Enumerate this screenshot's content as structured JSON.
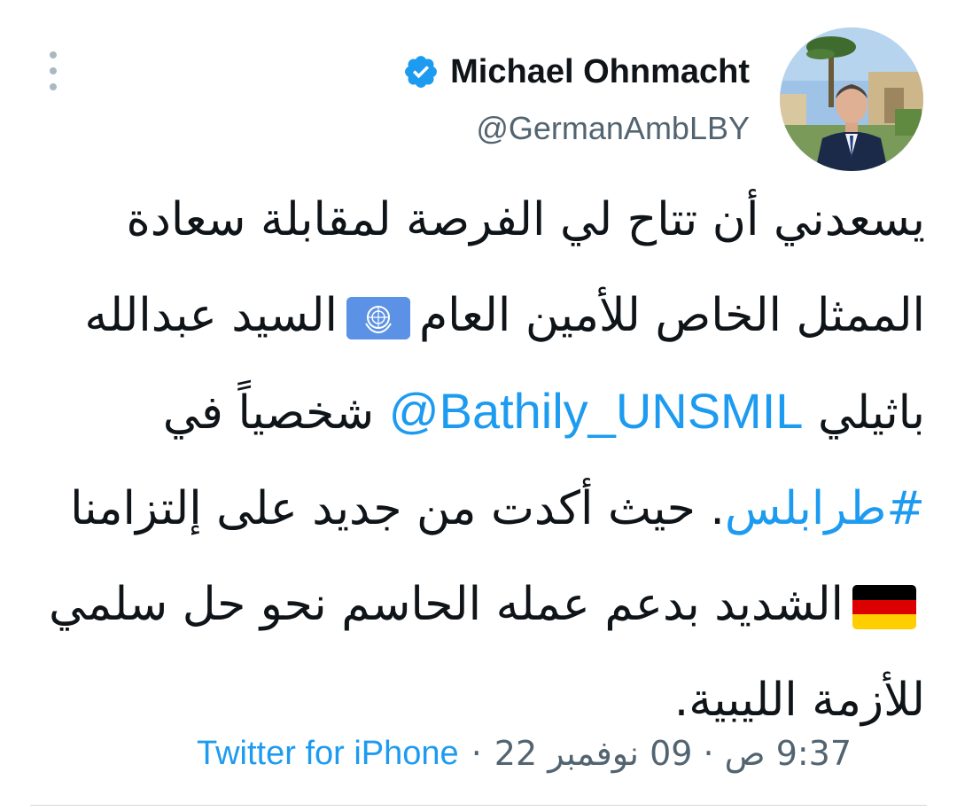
{
  "author": {
    "display_name": "Michael Ohnmacht",
    "handle": "@GermanAmbLBY",
    "verified": true,
    "avatar_icon": "profile-photo"
  },
  "tweet": {
    "seg1": "يسعدني أن تتاح لي الفرصة لمقابلة سعادة الممثل الخاص للأمين العام",
    "un_flag_icon": "united-nations-flag-icon",
    "seg2": "السيد عبدالله باثيلي",
    "mention": "@Bathily_UNSMIL",
    "seg3": "شخصياً في",
    "hashtag": "#طرابلس",
    "seg4": ". حيث أكدت من جديد على إلتزامنا",
    "germany_flag_icon": "germany-flag-icon",
    "seg5": "الشديد بدعم عمله الحاسم نحو حل سلمي للأزمة الليبية."
  },
  "meta": {
    "timestamp": "9:37 ص · 09 نوفمبر 22",
    "separator": "·",
    "source": "Twitter for iPhone"
  },
  "colors": {
    "link": "#1d9bf0",
    "text": "#0f1419",
    "secondary": "#536471",
    "verified": "#1d9bf0"
  }
}
